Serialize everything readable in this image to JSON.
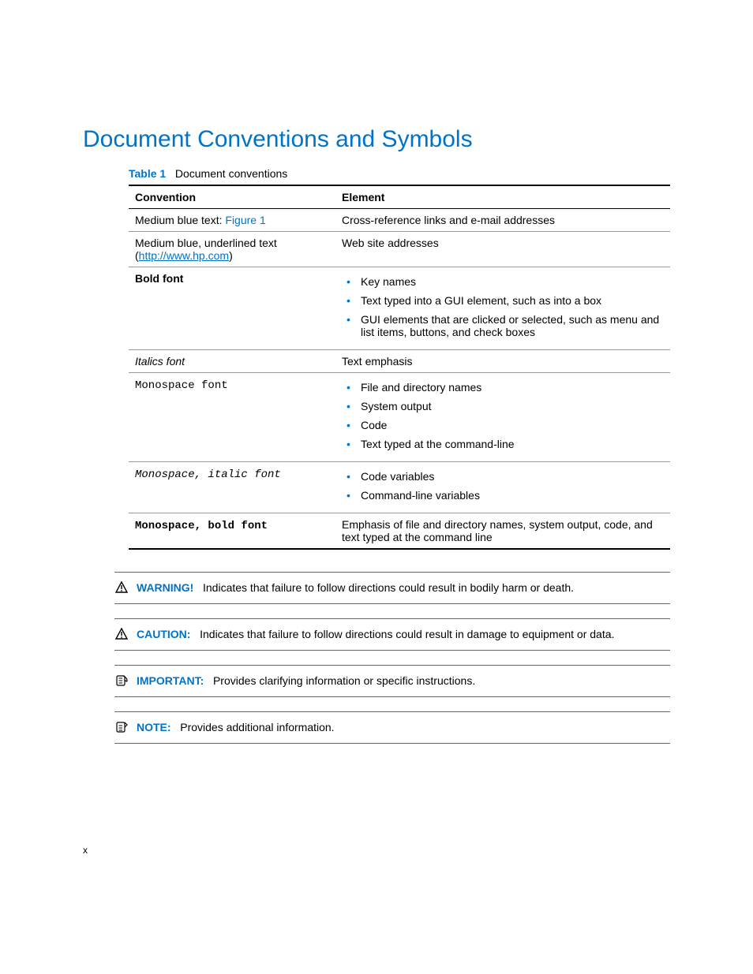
{
  "title": "Document Conventions and Symbols",
  "caption": {
    "label": "Table 1",
    "text": "Document conventions"
  },
  "headers": {
    "c1": "Convention",
    "c2": "Element"
  },
  "rows": {
    "r1": {
      "conv_prefix": "Medium blue text: ",
      "conv_link": "Figure 1",
      "elem": "Cross-reference links and e-mail addresses"
    },
    "r2": {
      "conv_line1": "Medium blue, underlined text",
      "conv_lparen": "(",
      "conv_url": "http://www.hp.com",
      "conv_rparen": ")",
      "elem": "Web site addresses"
    },
    "r3": {
      "conv": "Bold font",
      "items": {
        "0": "Key names",
        "1": "Text typed into a GUI element, such as into a box",
        "2": "GUI elements that are clicked or selected, such as menu and list items, buttons, and check boxes"
      }
    },
    "r4": {
      "conv": "Italics font",
      "elem": "Text emphasis"
    },
    "r5": {
      "conv": "Monospace font",
      "items": {
        "0": "File and directory names",
        "1": "System output",
        "2": "Code",
        "3": "Text typed at the command-line"
      }
    },
    "r6": {
      "conv": "Monospace, italic font",
      "items": {
        "0": "Code variables",
        "1": "Command-line variables"
      }
    },
    "r7": {
      "conv": "Monospace, bold font",
      "elem": "Emphasis of file and directory names, system output, code, and text typed at the command line"
    }
  },
  "admon": {
    "warning": {
      "label": "WARNING!",
      "text": "Indicates that failure to follow directions could result in bodily harm or death."
    },
    "caution": {
      "label": "CAUTION:",
      "text": "Indicates that failure to follow directions could result in damage to equipment or data."
    },
    "important": {
      "label": "IMPORTANT:",
      "text": "Provides clarifying information or specific instructions."
    },
    "note": {
      "label": "NOTE:",
      "text": "Provides additional information."
    }
  },
  "pagenum": "x"
}
